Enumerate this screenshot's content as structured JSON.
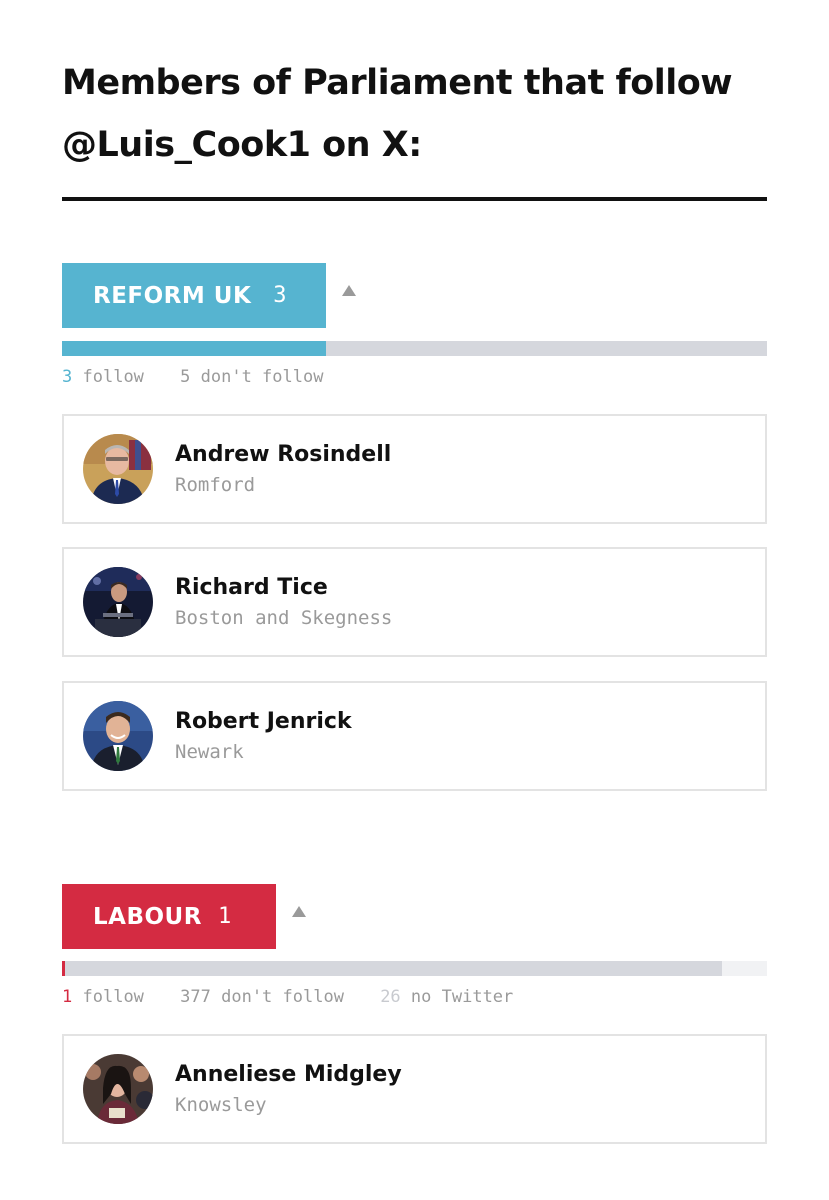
{
  "title": "Members of Parliament that follow @Luis_Cook1 on X:",
  "colors": {
    "reform": "#56b4d0",
    "labour": "#d42b42",
    "bar_bg": "#d5d7dd",
    "bar_bg_light": "#f1f2f4",
    "muted": "#9a9a9a"
  },
  "sections": [
    {
      "party": "REFORM UK",
      "count": "3",
      "stats": {
        "follow_num": "3",
        "follow_label": "follow",
        "dont_follow": "5 don't follow"
      },
      "bar": {
        "follow": 3,
        "dont_follow": 5
      },
      "mps": [
        {
          "name": "Andrew Rosindell",
          "seat": "Romford"
        },
        {
          "name": "Richard Tice",
          "seat": "Boston and Skegness"
        },
        {
          "name": "Robert Jenrick",
          "seat": "Newark"
        }
      ]
    },
    {
      "party": "LABOUR",
      "count": "1",
      "stats": {
        "follow_num": "1",
        "follow_label": "follow",
        "dont_follow": "377 don't follow",
        "no_twitter_num": "26",
        "no_twitter_label": "no Twitter"
      },
      "bar": {
        "follow": 1,
        "dont_follow": 377,
        "no_twitter": 26
      },
      "mps": [
        {
          "name": "Anneliese Midgley",
          "seat": "Knowsley"
        }
      ]
    }
  ]
}
